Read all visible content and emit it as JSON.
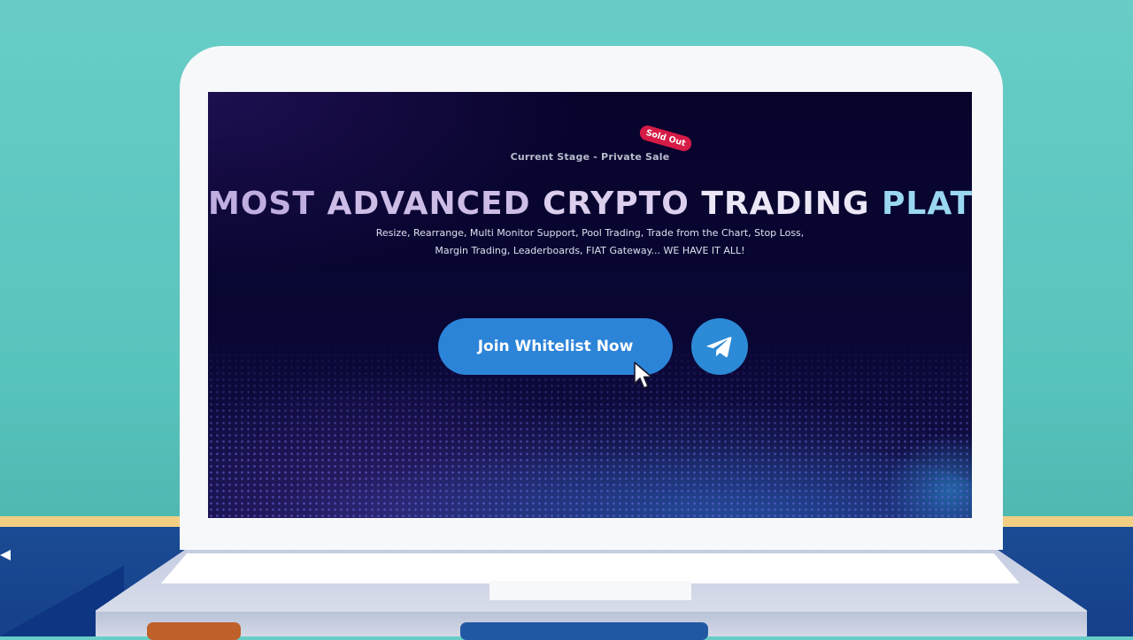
{
  "stage": {
    "label": "Current Stage - Private Sale",
    "badge": "Sold Out"
  },
  "hero": {
    "headline_words": [
      "MOST",
      "ADVANCED",
      "CRYPTO",
      "TRADING",
      "PLATFORM"
    ],
    "subtitle_line1": "Resize, Rearrange, Multi Monitor Support, Pool Trading, Trade from the Chart, Stop Loss,",
    "subtitle_line2": "Margin Trading, Leaderboards, FIAT Gateway... WE HAVE IT ALL!"
  },
  "cta": {
    "join_label": "Join Whitelist Now",
    "telegram_icon": "telegram-icon"
  },
  "colors": {
    "button_blue": "#2c84d9",
    "badge_red": "#d51b46",
    "screen_bg": "#07042c",
    "background_teal": "#68cdc7"
  }
}
